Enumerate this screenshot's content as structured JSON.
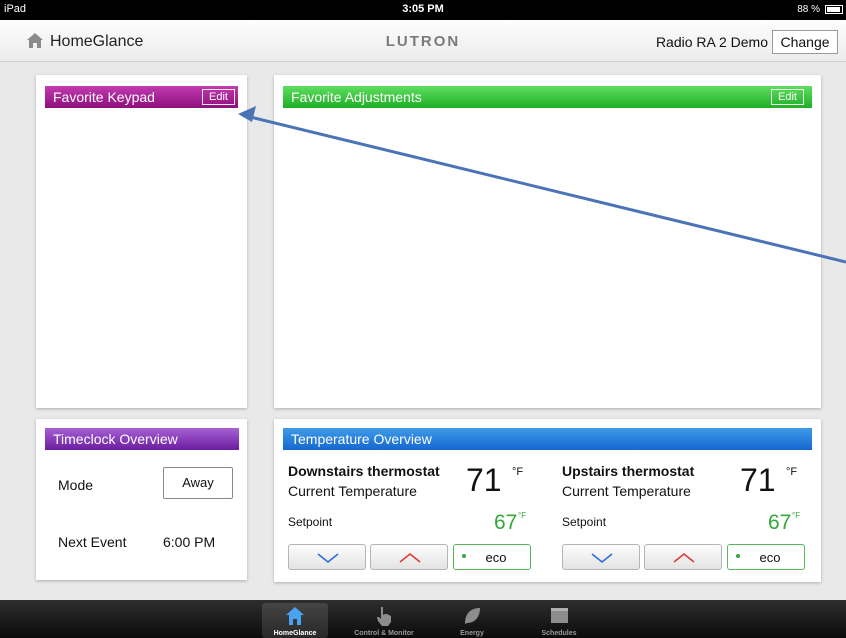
{
  "status_bar": {
    "device": "iPad",
    "time": "3:05 PM",
    "battery": "88 %"
  },
  "header": {
    "title": "HomeGlance",
    "brand": "LUTRON",
    "system_name": "Radio RA 2 Demo",
    "change_label": "Change"
  },
  "panels": {
    "keypad": {
      "title": "Favorite Keypad",
      "edit_label": "Edit",
      "color": "#a8239a"
    },
    "adjustments": {
      "title": "Favorite Adjustments",
      "edit_label": "Edit",
      "color": "#2fc43a"
    },
    "timeclock": {
      "title": "Timeclock Overview",
      "mode_label": "Mode",
      "mode_value": "Away",
      "next_event_label": "Next Event",
      "next_event_value": "6:00 PM",
      "color": "#8b3bbf"
    },
    "temperature": {
      "title": "Temperature Overview",
      "color": "#1f78db",
      "thermostats": [
        {
          "name": "Downstairs thermostat",
          "subtitle": "Current Temperature",
          "current": "71",
          "unit": "°F",
          "setpoint_label": "Setpoint",
          "setpoint": "67",
          "setpoint_unit": "°F",
          "eco_label": "eco"
        },
        {
          "name": "Upstairs thermostat",
          "subtitle": "Current Temperature",
          "current": "71",
          "unit": "°F",
          "setpoint_label": "Setpoint",
          "setpoint": "67",
          "setpoint_unit": "°F",
          "eco_label": "eco"
        }
      ]
    }
  },
  "tabbar": {
    "tabs": [
      {
        "label": "HomeGlance",
        "icon": "home-icon",
        "active": true
      },
      {
        "label": "Control & Monitor",
        "icon": "hand-icon",
        "active": false
      },
      {
        "label": "Energy",
        "icon": "leaf-icon",
        "active": false
      },
      {
        "label": "Schedules",
        "icon": "calendar-icon",
        "active": false
      }
    ]
  },
  "annotation": {
    "arrow_color": "#4a74b6"
  }
}
